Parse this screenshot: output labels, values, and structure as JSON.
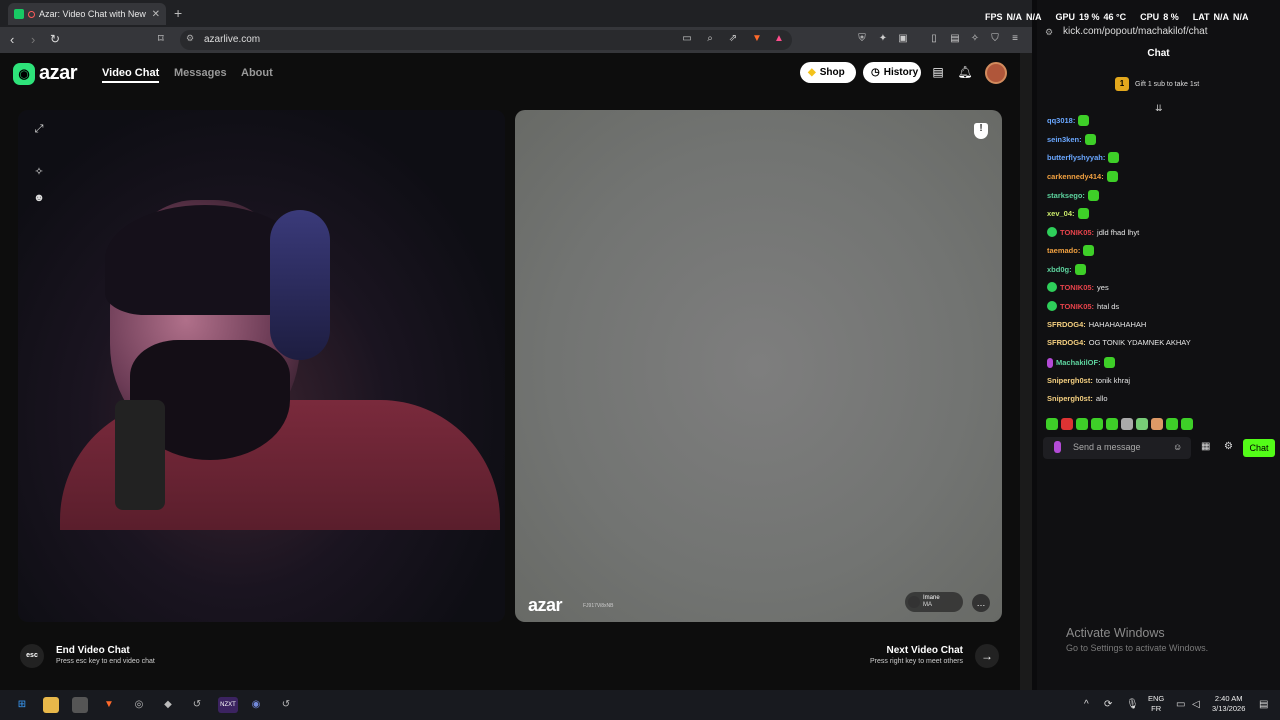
{
  "browser": {
    "tab_title": "Azar: Video Chat with New Pe",
    "url": "azarlive.com",
    "new_tab": "+",
    "tab_close": "✕"
  },
  "azar": {
    "logo": "azar",
    "nav": {
      "video_chat": "Video Chat",
      "messages": "Messages",
      "about": "About"
    },
    "shop": "Shop",
    "history": "History",
    "watermark": "azar",
    "watermark_id": "FJ917Vi8xNB",
    "partner": {
      "name": "Imane",
      "country": "MA"
    },
    "end": {
      "key": "esc",
      "title": "End Video Chat",
      "sub": "Press esc key to end video chat"
    },
    "next": {
      "title": "Next Video Chat",
      "sub": "Press right key to meet others"
    }
  },
  "osd": {
    "fps_label": "FPS",
    "fps": "N/A",
    "n1": "N/A",
    "gpu_label": "GPU",
    "gpu": "19 %",
    "gpu_temp": "46 °C",
    "cpu_label": "CPU",
    "cpu": "8 %",
    "lat_label": "LAT",
    "lat": "N/A",
    "n2": "N/A"
  },
  "kick": {
    "url": "kick.com/popout/machakilof/chat",
    "title": "Chat",
    "gift_badge": "1",
    "gift_text": "Gift 1 sub to take 1st",
    "messages": [
      {
        "user": "qq3018:",
        "text": "",
        "color": "#6aa7ff"
      },
      {
        "user": "sein3ken:",
        "text": "",
        "color": "#6aa7ff"
      },
      {
        "user": "butterflyshyyah:",
        "text": "",
        "color": "#6aa7ff"
      },
      {
        "user": "carkennedy414:",
        "text": "",
        "color": "#f0a040"
      },
      {
        "user": "starksego:",
        "text": "",
        "color": "#5dd39e"
      },
      {
        "user": "xev_04:",
        "text": "",
        "color": "#c9e86a"
      },
      {
        "user": "TONIK05:",
        "text": "jdld fhad lhyt",
        "color": "#e8434b"
      },
      {
        "user": "taemado:",
        "text": "",
        "color": "#f0a040"
      },
      {
        "user": "xbd0g:",
        "text": "",
        "color": "#5dd39e"
      },
      {
        "user": "TONIK05:",
        "text": "yes",
        "color": "#e8434b"
      },
      {
        "user": "TONIK05:",
        "text": "htal ds",
        "color": "#e8434b"
      },
      {
        "user": "SFRDOG4:",
        "text": "HAHAHAHAHAH",
        "color": "#f5d080"
      },
      {
        "user": "SFRDOG4:",
        "text": "OG TONIK YDAMNEK AKHAY",
        "color": "#f5d080"
      },
      {
        "user": "MachakilOF:",
        "text": "",
        "color": "#5dd39e"
      },
      {
        "user": "Snipergh0st:",
        "text": "tonik khraj",
        "color": "#f5d080"
      },
      {
        "user": "Snipergh0st:",
        "text": "allo",
        "color": "#f5d080"
      }
    ],
    "input_placeholder": "Send a message",
    "send_label": "Chat"
  },
  "windows": {
    "activate_title": "Activate Windows",
    "activate_sub": "Go to Settings to activate Windows.",
    "time": "2:40 AM",
    "date": "3/13/2026",
    "lang1": "ENG",
    "lang2": "FR"
  }
}
